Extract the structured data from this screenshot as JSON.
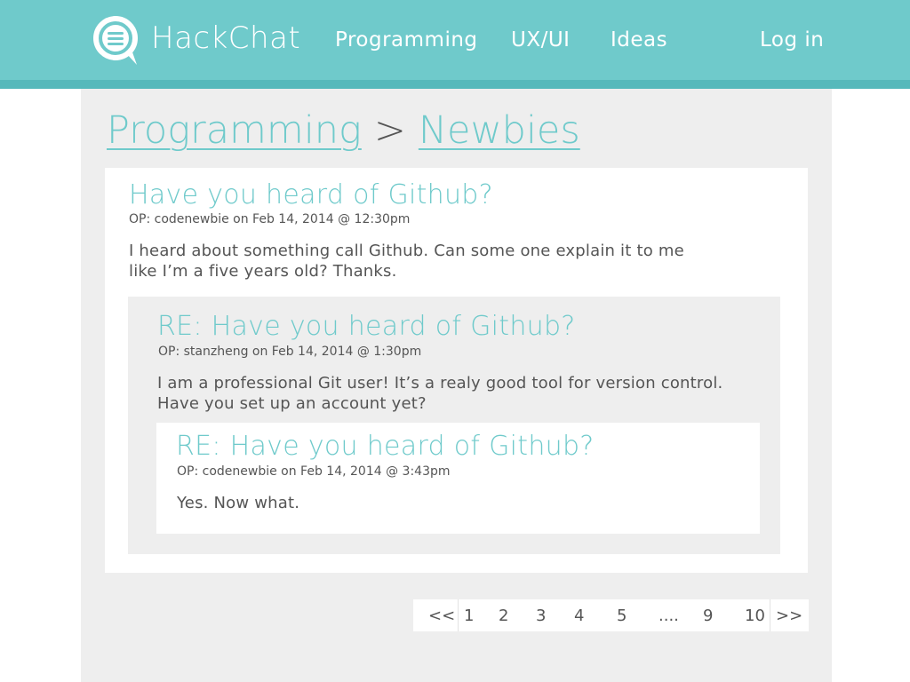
{
  "header": {
    "brand": "HackChat",
    "nav": {
      "programming": "Programming",
      "uxui": "UX/UI",
      "ideas": "Ideas",
      "login": "Log in"
    },
    "icon": "chat-bubble-menu-icon"
  },
  "breadcrumb": {
    "parent": "Programming",
    "separator": ">",
    "current": "Newbies"
  },
  "posts": [
    {
      "title": "Have you heard of Github?",
      "meta": "OP: codenewbie on Feb 14, 2014 @ 12:30pm",
      "body_line1": "I heard about something call Github. Can some one explain it to me",
      "body_line2": "like I’m a five years old? Thanks."
    },
    {
      "title": "RE: Have you heard of Github?",
      "meta": "OP: stanzheng on Feb 14, 2014 @ 1:30pm",
      "body_line1": "I am a professional Git user! It’s a realy good tool for version control.",
      "body_line2": "Have you set up an account yet?"
    },
    {
      "title": "RE: Have you heard of Github?",
      "meta": "OP: codenewbie on Feb 14, 2014 @ 3:43pm",
      "body_line1": "Yes. Now what."
    }
  ],
  "pagination": {
    "prev": "<<",
    "pages": [
      "1",
      "2",
      "3",
      "4",
      "5",
      "....",
      "9",
      "10"
    ],
    "next": ">>"
  },
  "colors": {
    "accent": "#6fcacb",
    "accent_dark": "#56b9bb",
    "panel": "#eeeeee",
    "text": "#555555"
  }
}
